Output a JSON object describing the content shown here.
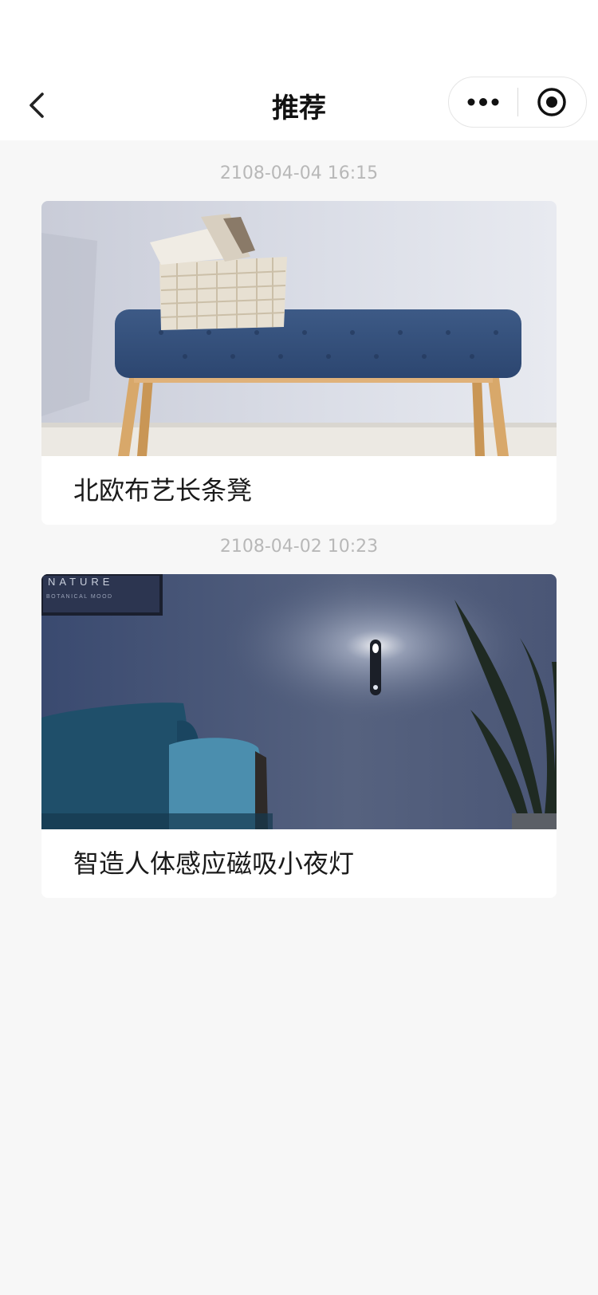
{
  "nav": {
    "title": "推荐",
    "back_icon": "chevron-left-icon",
    "more_icon": "more-dots-icon",
    "target_icon": "target-circle-icon"
  },
  "feed": [
    {
      "time": "2108-04-04 16:15",
      "title": "北欧布艺长条凳",
      "image": "bench-photo"
    },
    {
      "time": "2108-04-02 10:23",
      "title": "智造人体感应磁吸小夜灯",
      "image": "night-light-photo"
    }
  ],
  "image_text": {
    "poster_title": "NATURE",
    "poster_sub": "BOTANICAL MOOD"
  },
  "colors": {
    "background": "#f7f7f7",
    "card": "#ffffff",
    "timestamp": "#b8b8b8"
  }
}
